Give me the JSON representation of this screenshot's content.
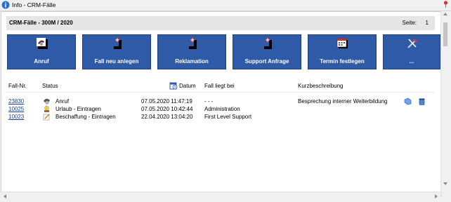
{
  "window": {
    "title": "Info - CRM-Fälle"
  },
  "header": {
    "title": "CRM-Fälle - 300M / 2020",
    "page_label": "Seite:",
    "page_number": "1"
  },
  "tiles": [
    {
      "label": "Anruf",
      "icon": "phone-icon"
    },
    {
      "label": "Fall neu anlegen",
      "icon": "new-case-icon"
    },
    {
      "label": "Reklamation",
      "icon": "complaint-icon"
    },
    {
      "label": "Support Anfrage",
      "icon": "support-icon"
    },
    {
      "label": "Termin festlegen",
      "icon": "calendar-icon"
    },
    {
      "label": "...",
      "icon": "tools-icon"
    }
  ],
  "columns": {
    "case_no": "Fall-Nr.",
    "status": "Status",
    "date": "Datum",
    "assigned": "Fall liegt bei",
    "description": "Kurzbeschreibung"
  },
  "rows": [
    {
      "case_no": "23830",
      "status": "Anruf",
      "date": "07.05.2020 11:47:19",
      "assigned": "- - -",
      "description": "Besprechung interner Weiterbildung"
    },
    {
      "case_no": "10025",
      "status": "Urlaub - Eintragen",
      "date": "07.05.2020 10:42:44",
      "assigned": "Administration",
      "description": ""
    },
    {
      "case_no": "10023",
      "status": "Beschaffung - Eintragen",
      "date": "22.04.2020 13:04:20",
      "assigned": "First Level Support",
      "description": ""
    }
  ],
  "colors": {
    "tile_bg": "#2f5aa8",
    "link": "#1a3fa3",
    "header_bg": "#e6e6e6"
  }
}
